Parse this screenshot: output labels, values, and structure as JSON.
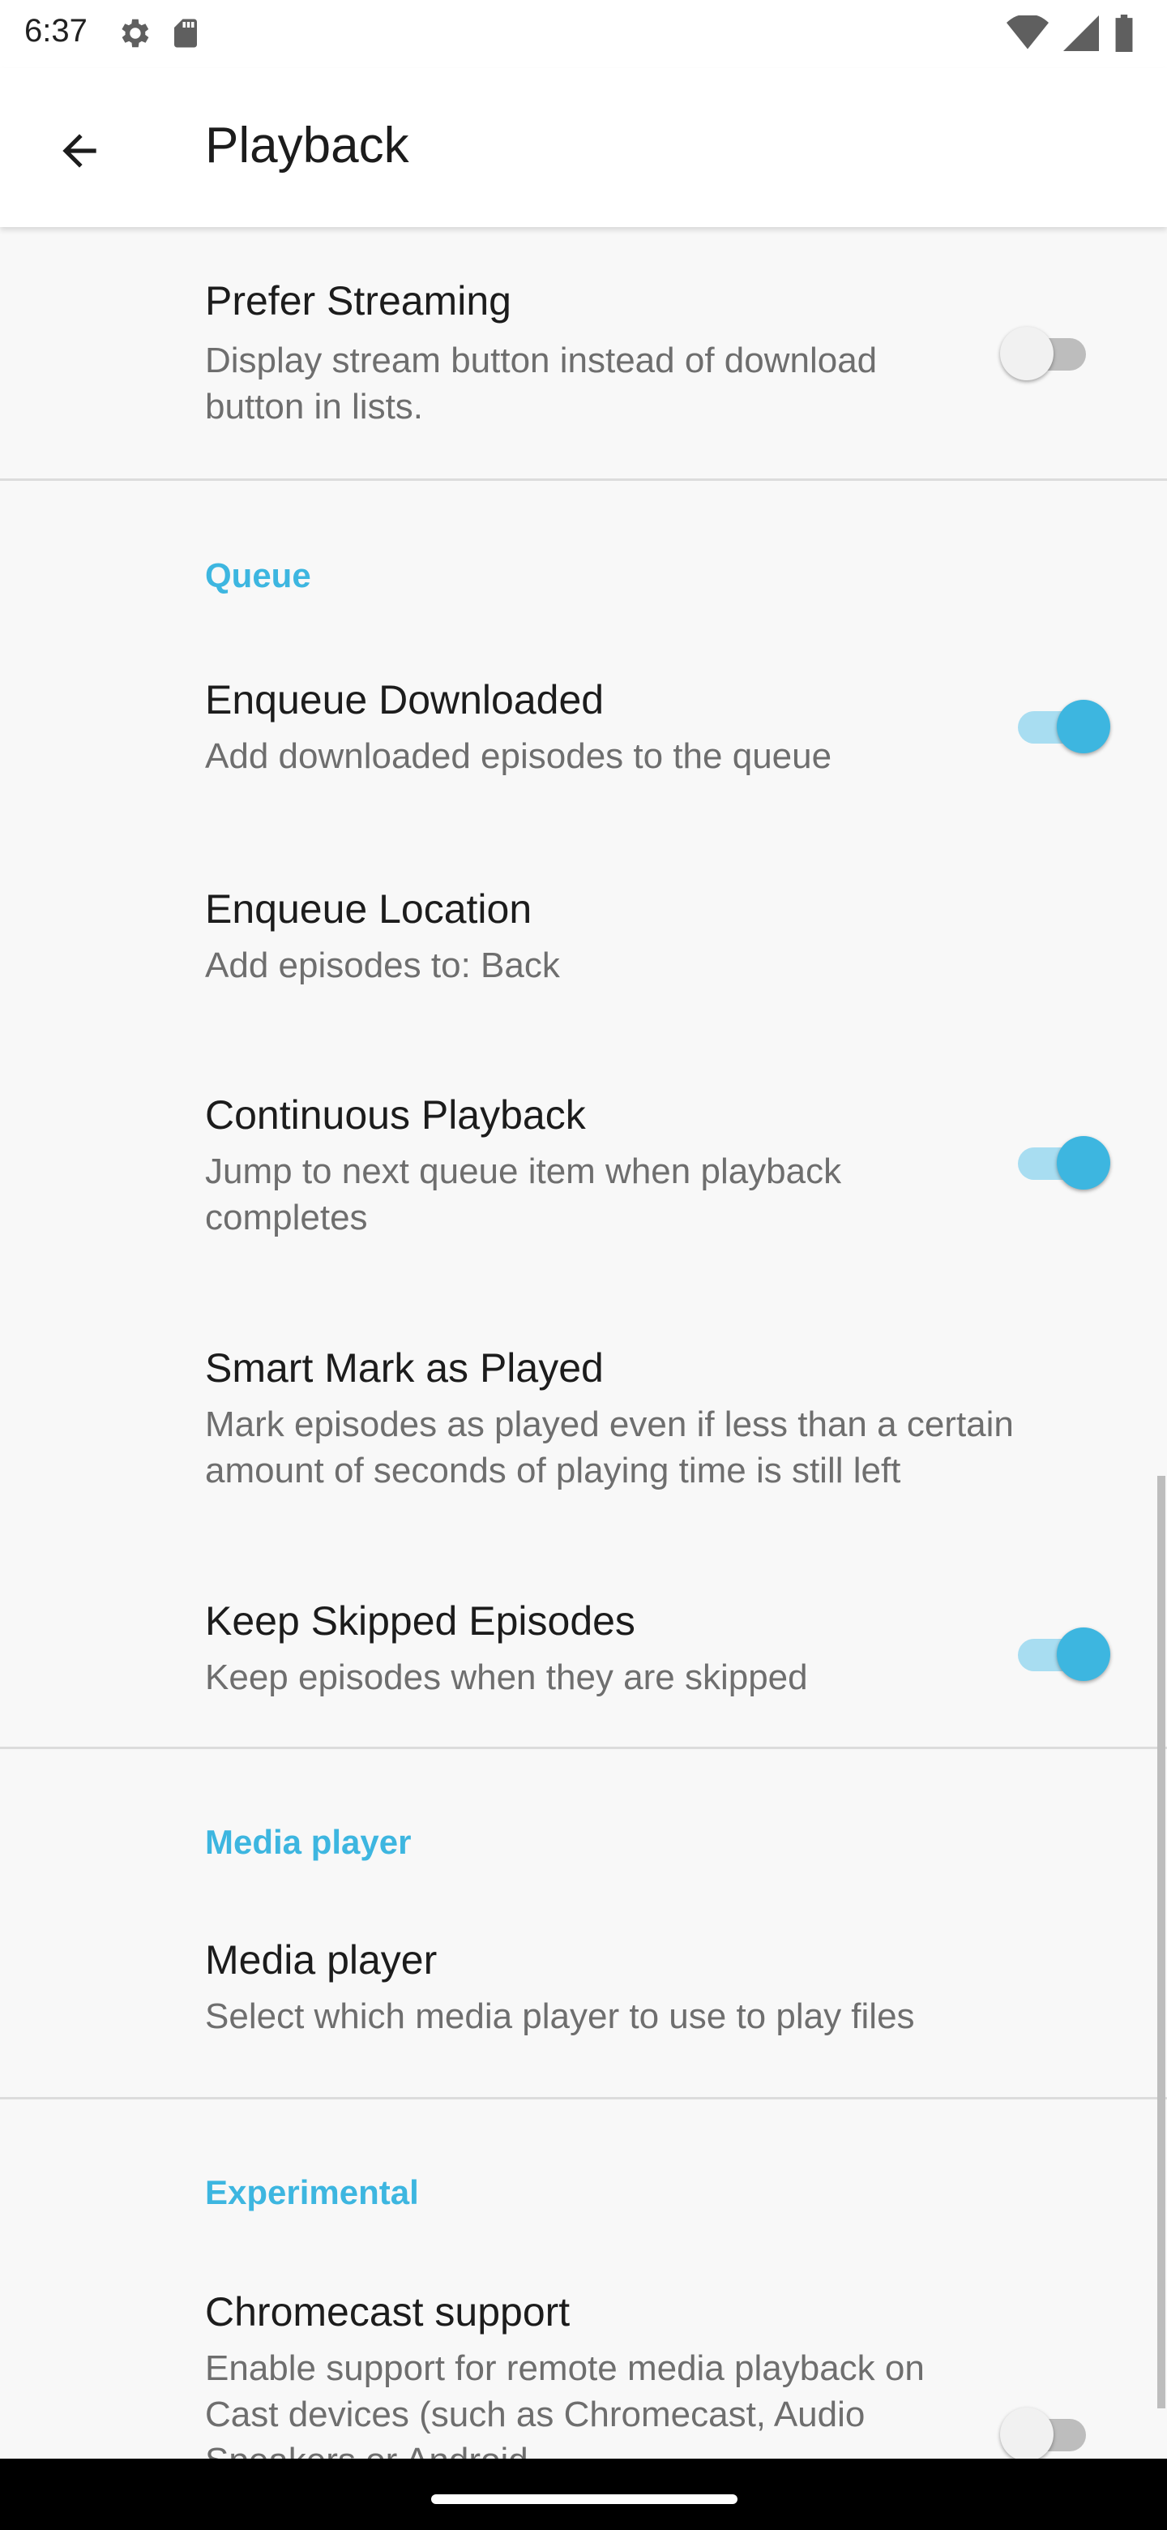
{
  "status_bar": {
    "time": "6:37",
    "icons": [
      "settings-icon",
      "sd-card-icon",
      "wifi-icon",
      "signal-icon",
      "battery-icon"
    ]
  },
  "app_bar": {
    "back_icon": "arrow-back-icon",
    "title": "Playback"
  },
  "items": {
    "prefer_streaming": {
      "title": "Prefer Streaming",
      "summary": "Display stream button instead of download button in lists.",
      "checked": false
    },
    "queue_header": "Queue",
    "enqueue_downloaded": {
      "title": "Enqueue Downloaded",
      "summary": "Add downloaded episodes to the queue",
      "checked": true
    },
    "enqueue_location": {
      "title": "Enqueue Location",
      "summary": "Add episodes to: Back"
    },
    "continuous_playback": {
      "title": "Continuous Playback",
      "summary": "Jump to next queue item when playback completes",
      "checked": true
    },
    "smart_mark": {
      "title": "Smart Mark as Played",
      "summary": "Mark episodes as played even if less than a certain amount of seconds of playing time is still left"
    },
    "keep_skipped": {
      "title": "Keep Skipped Episodes",
      "summary": "Keep episodes when they are skipped",
      "checked": true
    },
    "media_player_header": "Media player",
    "media_player": {
      "title": "Media player",
      "summary": "Select which media player to use to play files"
    },
    "experimental_header": "Experimental",
    "chromecast": {
      "title": "Chromecast support",
      "summary": "Enable support for remote media playback on Cast devices (such as Chromecast, Audio Speakers or Android",
      "checked": false
    }
  },
  "colors": {
    "accent": "#3DB6E0",
    "accent_track": "#A8DDF1",
    "background": "#F8F8F8"
  }
}
